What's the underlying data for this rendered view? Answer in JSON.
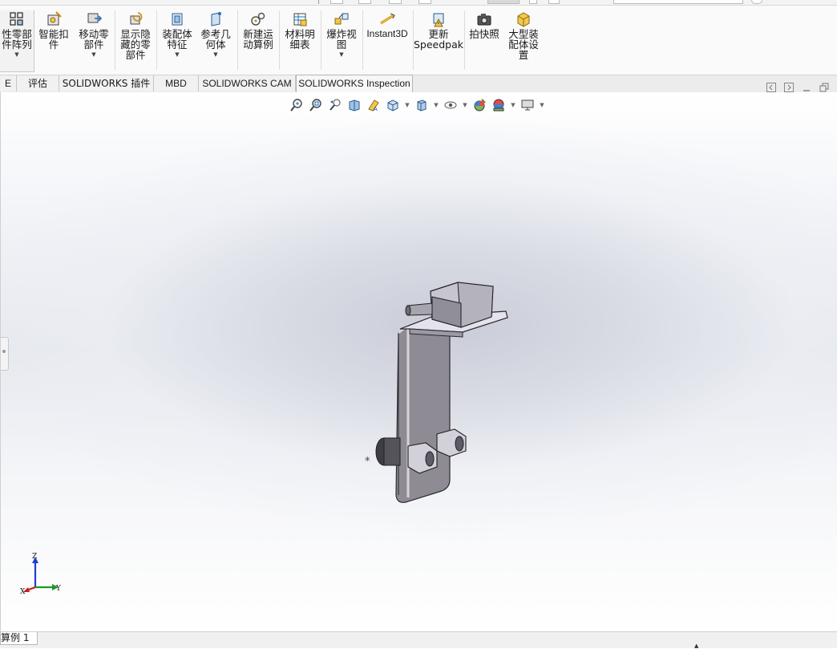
{
  "ribbon": {
    "buttons": [
      {
        "id": "linear-pattern",
        "label": "性零部\n件阵列",
        "has_dropdown": true,
        "icon": "pattern-icon"
      },
      {
        "id": "smart-fasteners",
        "label": "智能扣\n件",
        "has_dropdown": false,
        "icon": "fastener-icon"
      },
      {
        "id": "move-component",
        "label": "移动零\n部件",
        "has_dropdown": true,
        "icon": "move-icon"
      },
      {
        "id": "show-hidden",
        "label": "显示隐\n藏的零\n部件",
        "has_dropdown": false,
        "icon": "show-hidden-icon"
      },
      {
        "id": "assembly-features",
        "label": "装配体\n特征",
        "has_dropdown": true,
        "icon": "assembly-feature-icon"
      },
      {
        "id": "reference-geometry",
        "label": "参考几\n何体",
        "has_dropdown": true,
        "icon": "reference-geometry-icon"
      },
      {
        "id": "new-motion-study",
        "label": "新建运\n动算例",
        "has_dropdown": false,
        "icon": "motion-study-icon"
      },
      {
        "id": "bill-of-materials",
        "label": "材料明\n细表",
        "has_dropdown": false,
        "icon": "bom-icon"
      },
      {
        "id": "exploded-view",
        "label": "爆炸视\n图",
        "has_dropdown": true,
        "icon": "explode-icon"
      },
      {
        "id": "instant3d",
        "label": "Instant3D",
        "has_dropdown": false,
        "icon": "instant3d-icon"
      },
      {
        "id": "update-speedpak",
        "label": "更新\nSpeedpak",
        "has_dropdown": false,
        "icon": "speedpak-icon"
      },
      {
        "id": "take-snapshot",
        "label": "拍快照",
        "has_dropdown": false,
        "icon": "camera-icon"
      },
      {
        "id": "large-assembly",
        "label": "大型装\n配体设\n置",
        "has_dropdown": false,
        "icon": "large-assembly-icon"
      }
    ]
  },
  "tabs": [
    {
      "label": "E"
    },
    {
      "label": "评估"
    },
    {
      "label": "SOLIDWORKS 插件"
    },
    {
      "label": "MBD"
    },
    {
      "label": "SOLIDWORKS CAM"
    },
    {
      "label": "SOLIDWORKS Inspection"
    }
  ],
  "active_tab": "SOLIDWORKS Inspection",
  "heads_up_toolbar": [
    {
      "icon": "zoom-to-fit-icon"
    },
    {
      "icon": "zoom-to-area-icon"
    },
    {
      "icon": "previous-view-icon"
    },
    {
      "icon": "section-view-icon"
    },
    {
      "icon": "dynamic-annotation-icon"
    },
    {
      "icon": "view-orientation-icon",
      "dropdown": true
    },
    {
      "icon": "display-style-icon",
      "dropdown": true
    },
    {
      "icon": "hide-show-icon",
      "dropdown": true
    },
    {
      "icon": "edit-appearance-icon"
    },
    {
      "icon": "apply-scene-icon",
      "dropdown": true
    },
    {
      "icon": "view-settings-icon",
      "dropdown": true
    }
  ],
  "triad": {
    "x": "X",
    "y": "Y",
    "z": "Z"
  },
  "status": {
    "study_tab": "算例 1"
  }
}
